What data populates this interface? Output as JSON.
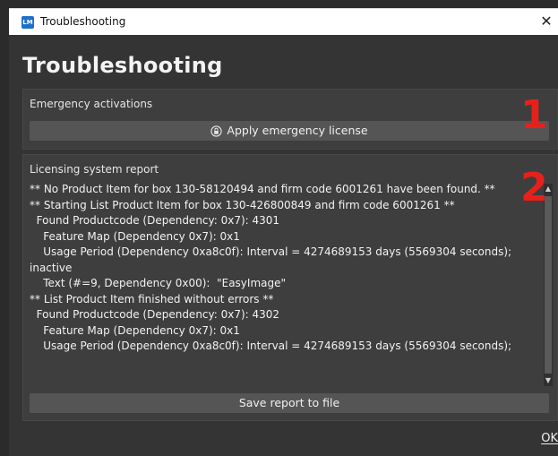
{
  "window": {
    "icon_text": "LM",
    "title": "Troubleshooting",
    "close_glyph": "✕"
  },
  "heading": "Troubleshooting",
  "emergency": {
    "title": "Emergency activations",
    "apply_button_label": "Apply emergency license",
    "apply_button_icon": "lock-icon"
  },
  "report": {
    "title": "Licensing system report",
    "lines": [
      "** No Product Item for box 130-58120494 and firm code 6001261 have been found. **",
      "** Starting List Product Item for box 130-426800849 and firm code 6001261 **",
      "  Found Productcode (Dependency: 0x7): 4301",
      "    Feature Map (Dependency 0x7): 0x1",
      "    Usage Period (Dependency 0xa8c0f): Interval = 4274689153 days (5569304 seconds);",
      "inactive",
      "    Text (#=9, Dependency 0x00):  \"EasyImage\"",
      "** List Product Item finished without errors **",
      "  Found Productcode (Dependency: 0x7): 4302",
      "    Feature Map (Dependency 0x7): 0x1",
      "    Usage Period (Dependency 0xa8c0f): Interval = 4274689153 days (5569304 seconds);"
    ],
    "save_button_label": "Save report to file"
  },
  "annotations": {
    "marker1": "1",
    "marker2": "2"
  },
  "ok_label": "OK",
  "colors": {
    "background": "#343434",
    "panel": "#3e3e3e",
    "button": "#555555",
    "marker": "#e8201a"
  }
}
